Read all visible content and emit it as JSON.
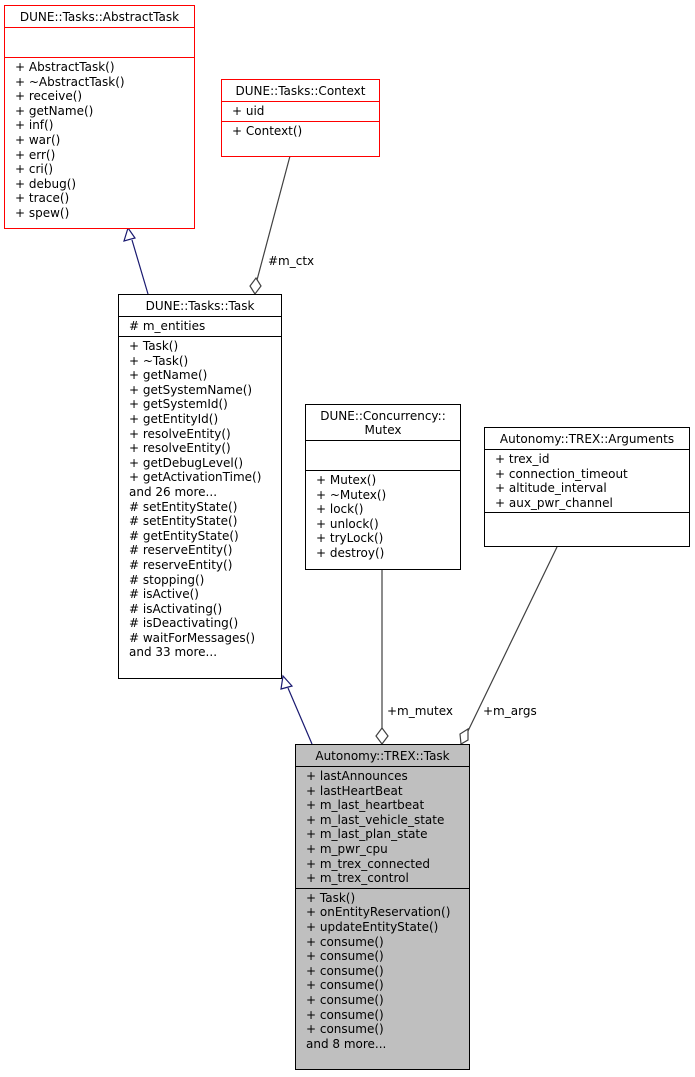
{
  "classes": {
    "abstract_task": {
      "name": "DUNE::Tasks::AbstractTask",
      "attributes": [],
      "methods": [
        "+ AbstractTask()",
        "+ ~AbstractTask()",
        "+ receive()",
        "+ getName()",
        "+ inf()",
        "+ war()",
        "+ err()",
        "+ cri()",
        "+ debug()",
        "+ trace()",
        "+ spew()"
      ]
    },
    "context": {
      "name": "DUNE::Tasks::Context",
      "attributes": [
        "+ uid"
      ],
      "methods": [
        "+ Context()"
      ]
    },
    "task": {
      "name": "DUNE::Tasks::Task",
      "attributes": [
        "# m_entities"
      ],
      "methods": [
        "+ Task()",
        "+ ~Task()",
        "+ getName()",
        "+ getSystemName()",
        "+ getSystemId()",
        "+ getEntityId()",
        "+ resolveEntity()",
        "+ resolveEntity()",
        "+ getDebugLevel()",
        "+ getActivationTime()",
        "and 26 more...",
        "# setEntityState()",
        "# setEntityState()",
        "# getEntityState()",
        "# reserveEntity()",
        "# reserveEntity()",
        "# stopping()",
        "# isActive()",
        "# isActivating()",
        "# isDeactivating()",
        "# waitForMessages()",
        "and 33 more..."
      ]
    },
    "mutex": {
      "name": "DUNE::Concurrency::\nMutex",
      "attributes": [],
      "methods": [
        "+ Mutex()",
        "+ ~Mutex()",
        "+ lock()",
        "+ unlock()",
        "+ tryLock()",
        "+ destroy()"
      ]
    },
    "arguments": {
      "name": "Autonomy::TREX::Arguments",
      "attributes": [
        "+ trex_id",
        "+ connection_timeout",
        "+ altitude_interval",
        "+ aux_pwr_channel"
      ],
      "methods": []
    },
    "trex_task": {
      "name": "Autonomy::TREX::Task",
      "attributes": [
        "+ lastAnnounces",
        "+ lastHeartBeat",
        "+ m_last_heartbeat",
        "+ m_last_vehicle_state",
        "+ m_last_plan_state",
        "+ m_pwr_cpu",
        "+ m_trex_connected",
        "+ m_trex_control"
      ],
      "methods": [
        "+ Task()",
        "+ onEntityReservation()",
        "+ updateEntityState()",
        "+ consume()",
        "+ consume()",
        "+ consume()",
        "+ consume()",
        "+ consume()",
        "+ consume()",
        "+ consume()",
        "and 8 more..."
      ]
    }
  },
  "edge_labels": {
    "ctx": "#m_ctx",
    "mutex": "+m_mutex",
    "args": "+m_args"
  },
  "colors": {
    "external_border": "#ff0000",
    "inheritance_edge": "#191970",
    "usage_edge": "#404040",
    "current_fill": "#bfbfbf"
  }
}
